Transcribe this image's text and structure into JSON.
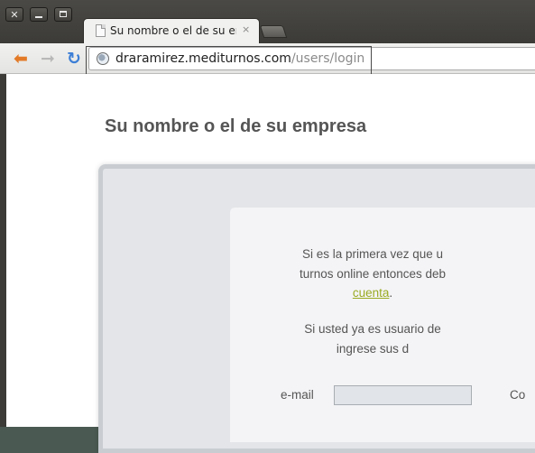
{
  "window": {
    "close_label": "✕",
    "tab_title": "Su nombre o el de su empr",
    "tab_close": "×"
  },
  "toolbar": {
    "back_icon": "arrow-left-icon",
    "forward_icon": "arrow-right-icon",
    "reload_icon": "reload-icon",
    "url_host": "draramirez.mediturnos.com",
    "url_path": "/users/login"
  },
  "page": {
    "site_title": "Su nombre o el de su empresa",
    "message_first_time": {
      "line1": "Si es la primera vez que u",
      "line2": "turnos online entonces deb",
      "link": "cuenta",
      "after_link": "."
    },
    "message_existing": {
      "line1": "Si usted ya es usuario de",
      "line2": "ingrese sus d"
    },
    "login_form": {
      "email_label": "e-mail",
      "email_value": "",
      "password_label": "Co"
    }
  },
  "colors": {
    "link": "#9aab23",
    "back_arrow": "#e27a27",
    "reload": "#3d7fd6",
    "title_text": "#555555"
  }
}
